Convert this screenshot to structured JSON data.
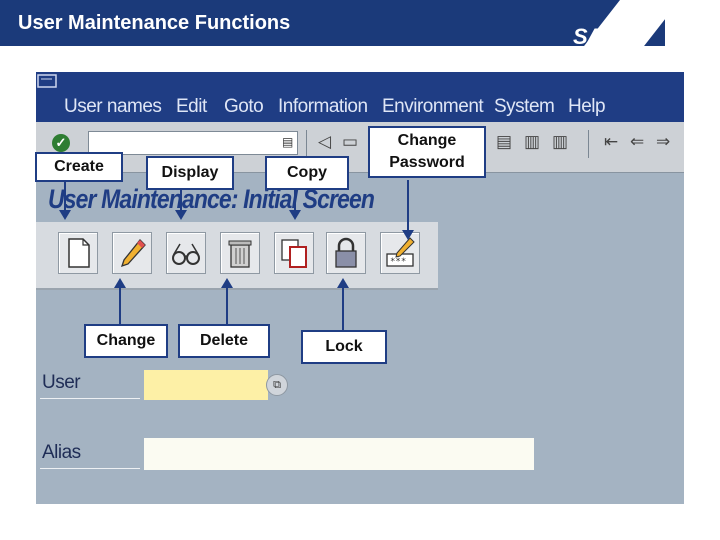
{
  "slide": {
    "title": "User Maintenance Functions",
    "logo": "SAP"
  },
  "menu": {
    "items": [
      "User names",
      "Edit",
      "Goto",
      "Information",
      "Environment",
      "System",
      "Help"
    ]
  },
  "screen": {
    "title": "User Maintenance: Initial Screen"
  },
  "app_toolbar": {
    "buttons": [
      {
        "icon": "create-icon"
      },
      {
        "icon": "change-pencil-icon"
      },
      {
        "icon": "display-glasses-icon"
      },
      {
        "icon": "delete-trash-icon"
      },
      {
        "icon": "copy-icon"
      },
      {
        "icon": "lock-icon"
      },
      {
        "icon": "change-password-icon"
      }
    ]
  },
  "fields": {
    "user_label": "User",
    "user_value": "",
    "alias_label": "Alias",
    "alias_value": ""
  },
  "callouts": {
    "create": "Create",
    "display": "Display",
    "copy": "Copy",
    "change_password_line1": "Change",
    "change_password_line2": "Password",
    "change": "Change",
    "delete": "Delete",
    "lock": "Lock"
  },
  "colors": {
    "header_blue": "#1b3a7a",
    "window_bg": "#a4b3c2",
    "user_field": "#fdf0a6"
  }
}
